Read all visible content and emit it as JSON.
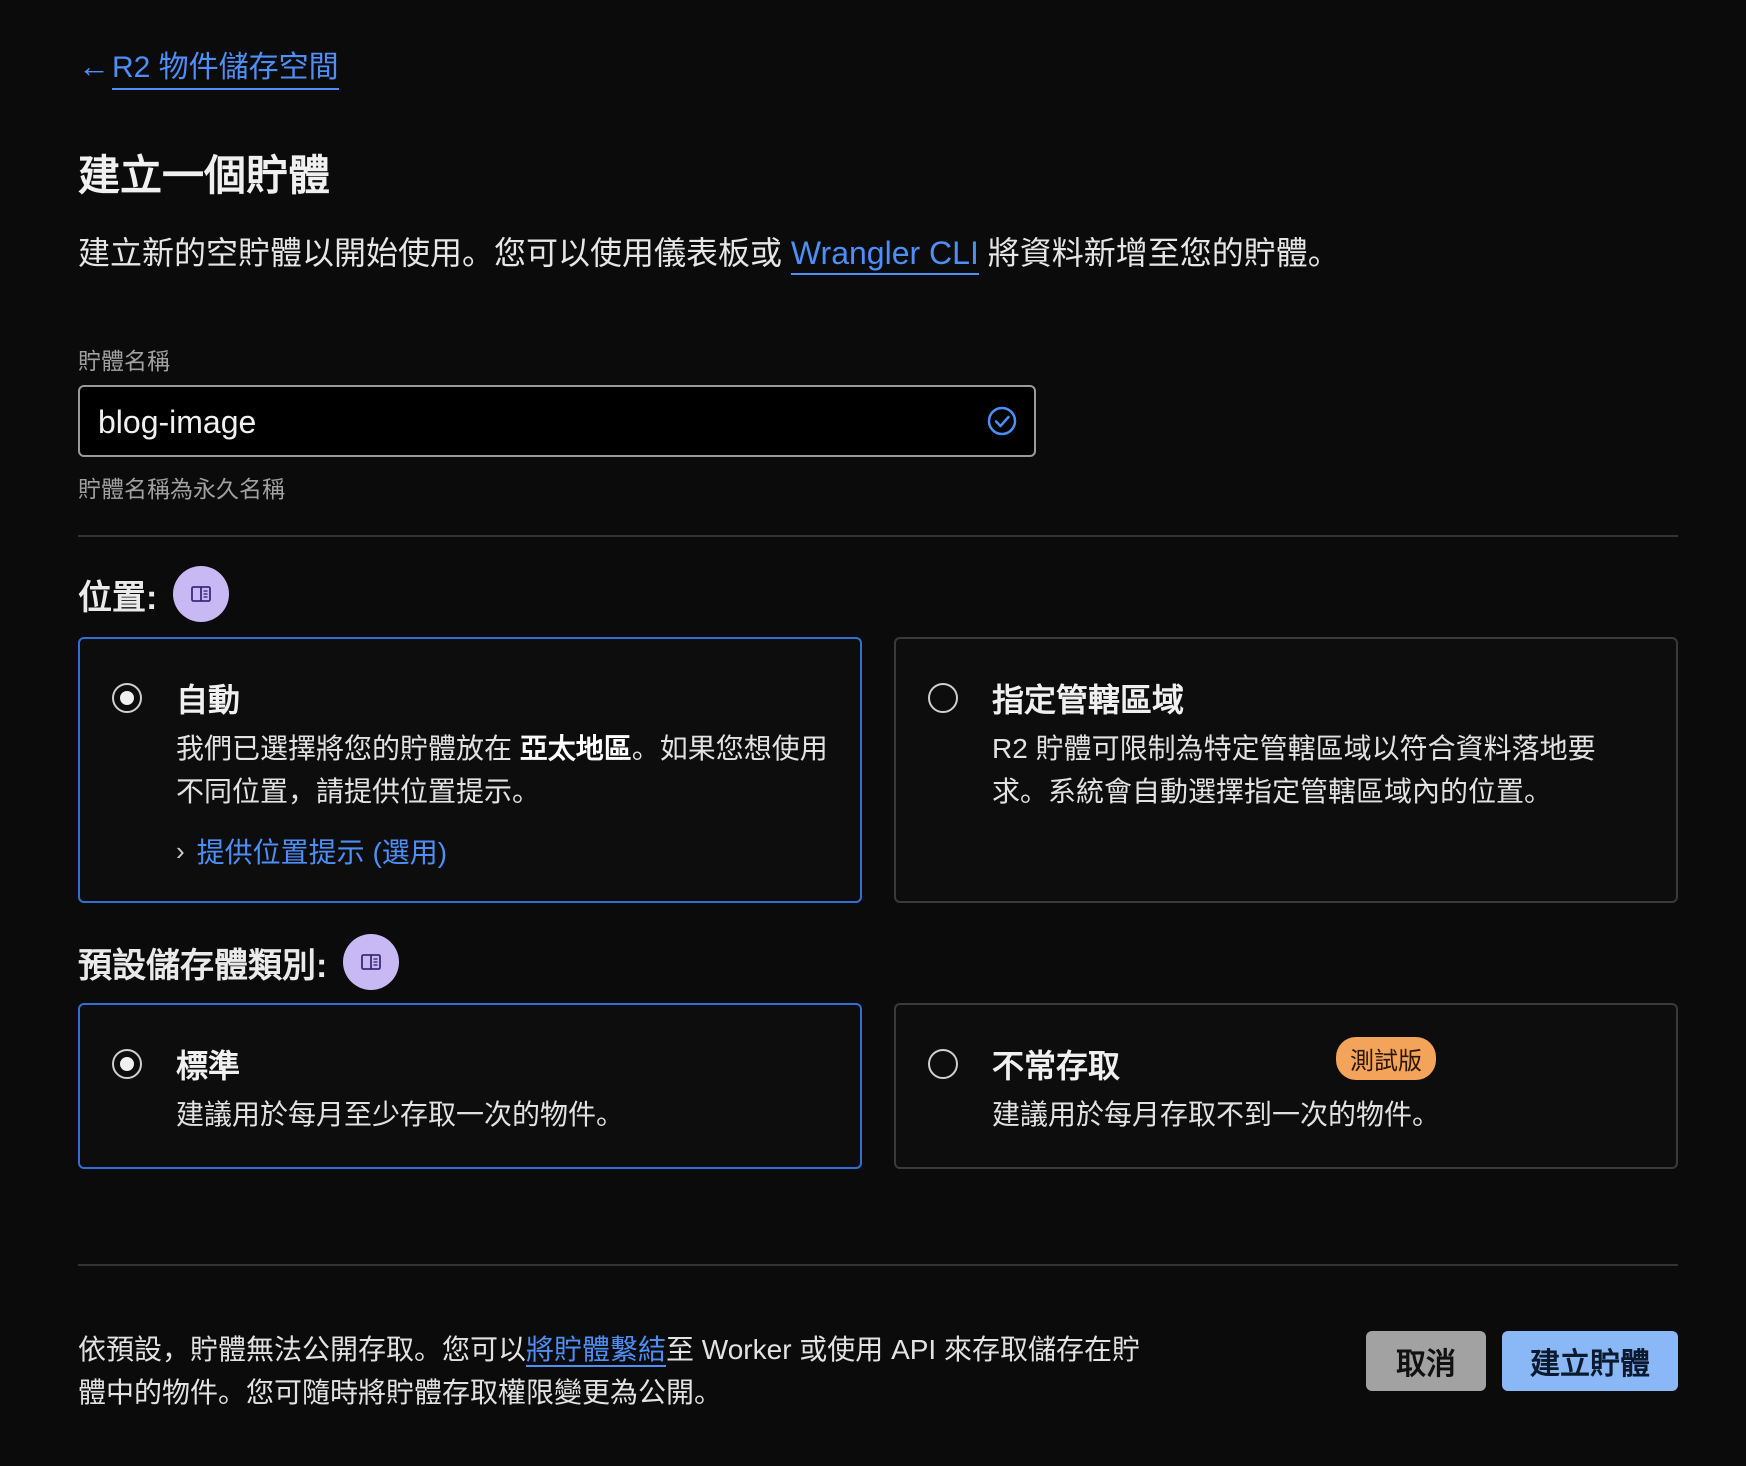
{
  "header": {
    "back_arrow": "←",
    "back_label": "R2 物件儲存空間",
    "title": "建立一個貯體",
    "desc_before": "建立新的空貯體以開始使用。您可以使用儀表板或 ",
    "desc_link": "Wrangler CLI",
    "desc_after": " 將資料新增至您的貯體。"
  },
  "bucket_name": {
    "label": "貯體名稱",
    "value": "blog-image",
    "help": "貯體名稱為永久名稱",
    "valid_icon": "check-circle-icon"
  },
  "location": {
    "heading": "位置:",
    "info_icon": "book-icon",
    "options": [
      {
        "title": "自動",
        "body_before": "我們已選擇將您的貯體放在 ",
        "body_bold": "亞太地區",
        "body_after": "。如果您想使用",
        "body_line2": "不同位置，請提供位置提示。",
        "hint_chevron": "›",
        "hint_link": "提供位置提示 (選用)",
        "selected": true
      },
      {
        "title": "指定管轄區域",
        "body_line1": "R2 貯體可限制為特定管轄區域以符合資料落地要",
        "body_line2": "求。系統會自動選擇指定管轄區域內的位置。",
        "selected": false
      }
    ]
  },
  "storage_class": {
    "heading": "預設儲存體類別:",
    "info_icon": "book-icon",
    "options": [
      {
        "title": "標準",
        "body": "建議用於每月至少存取一次的物件。",
        "selected": true
      },
      {
        "title": "不常存取",
        "badge": "測試版",
        "body": "建議用於每月存取不到一次的物件。",
        "selected": false
      }
    ]
  },
  "footer": {
    "text_before": "依預設，貯體無法公開存取。您可以",
    "text_link": "將貯體繫結",
    "text_after_line1": "至 Worker 或使用 API 來存取儲存在貯",
    "text_line2": "體中的物件。您可隨時將貯體存取權限變更為公開。",
    "cancel_label": "取消",
    "create_label": "建立貯體"
  },
  "colors": {
    "background": "#0b0b0b",
    "link": "#4d8ff7",
    "selected_border": "#2f6fd6",
    "info_badge": "#c8b9f5",
    "beta_badge": "#f4a45a",
    "primary_button": "#8ab8f7",
    "cancel_button": "#a2a2a2"
  }
}
